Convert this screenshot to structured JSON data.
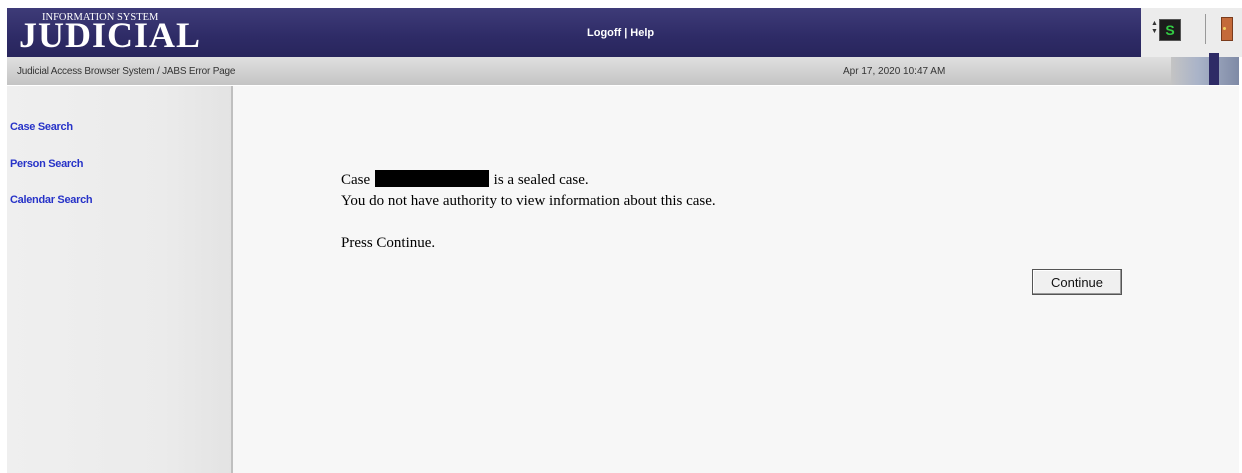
{
  "header": {
    "logo_small": "INFORMATION SYSTEM",
    "logo_big": "JUDICIAL",
    "logoff_label": "Logoff",
    "separator": "|",
    "help_label": "Help",
    "tray": {
      "s_icon_text": "S",
      "icons": [
        "scroll-arrows-icon",
        "s-icon",
        "door-exit-icon"
      ]
    }
  },
  "subbar": {
    "breadcrumb": "Judicial Access Browser System / JABS Error Page",
    "datetime": "Apr 17, 2020 10:47 AM"
  },
  "sidebar": {
    "items": [
      {
        "label": "Case Search"
      },
      {
        "label": "Person Search"
      },
      {
        "label": "Calendar Search"
      }
    ]
  },
  "main": {
    "case_prefix": "Case",
    "case_suffix": "is a sealed case.",
    "line2": "You do not have authority to view information about this case.",
    "line3": "Press Continue.",
    "continue_label": "Continue"
  },
  "colors": {
    "header_bg": "#2e2b66",
    "link": "#2733c8",
    "subbar_bg": "#cfcfcf"
  }
}
